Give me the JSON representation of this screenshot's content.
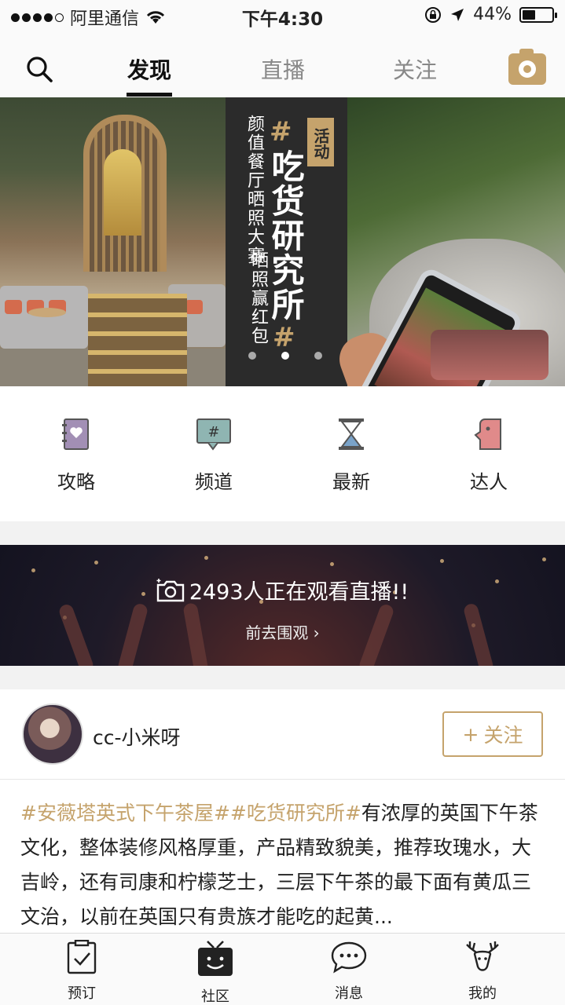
{
  "status_bar": {
    "carrier": "阿里通信",
    "time": "下午4:30",
    "battery": "44%",
    "battery_level": 0.44
  },
  "top_nav": {
    "tabs": [
      {
        "label": "发现",
        "active": true
      },
      {
        "label": "直播",
        "active": false
      },
      {
        "label": "关注",
        "active": false
      }
    ],
    "search_icon": "search-icon",
    "camera_icon": "camera-icon"
  },
  "banner": {
    "tag": "活动",
    "title": "吃货研究所",
    "hash": "#",
    "subtitle_line1": "颜值餐厅晒照大赛",
    "subtitle_line2": "晒照赢红包",
    "pages": 3,
    "active_page": 2
  },
  "quick_links": [
    {
      "label": "攻略",
      "icon": "guide-book-icon",
      "color": "#a28fb5"
    },
    {
      "label": "频道",
      "icon": "channel-hash-icon",
      "color": "#8fb5b2"
    },
    {
      "label": "最新",
      "icon": "hourglass-icon",
      "color": "#7aa3c9"
    },
    {
      "label": "达人",
      "icon": "expert-head-icon",
      "color": "#e08a8a"
    }
  ],
  "live": {
    "count_text": "2493人正在观看直播!!",
    "cta": "前去围观"
  },
  "post": {
    "username": "cc-小米呀",
    "follow_label": "关注",
    "tags": "#安薇塔英式下午茶屋##吃货研究所#",
    "body": "有浓厚的英国下午茶文化，整体装修风格厚重，产品精致貌美，推荐玫瑰水，大吉岭，还有司康和柠檬芝士，三层下午茶的最下面有黄瓜三文治，以前在英国只有贵族才能吃的起黄..."
  },
  "tab_bar": [
    {
      "label": "预订",
      "icon": "clipboard-check-icon"
    },
    {
      "label": "社区",
      "icon": "tv-smile-icon",
      "active": true
    },
    {
      "label": "消息",
      "icon": "chat-bubble-icon"
    },
    {
      "label": "我的",
      "icon": "deer-antler-icon"
    }
  ],
  "colors": {
    "accent": "#c5a36c",
    "text": "#222222"
  }
}
